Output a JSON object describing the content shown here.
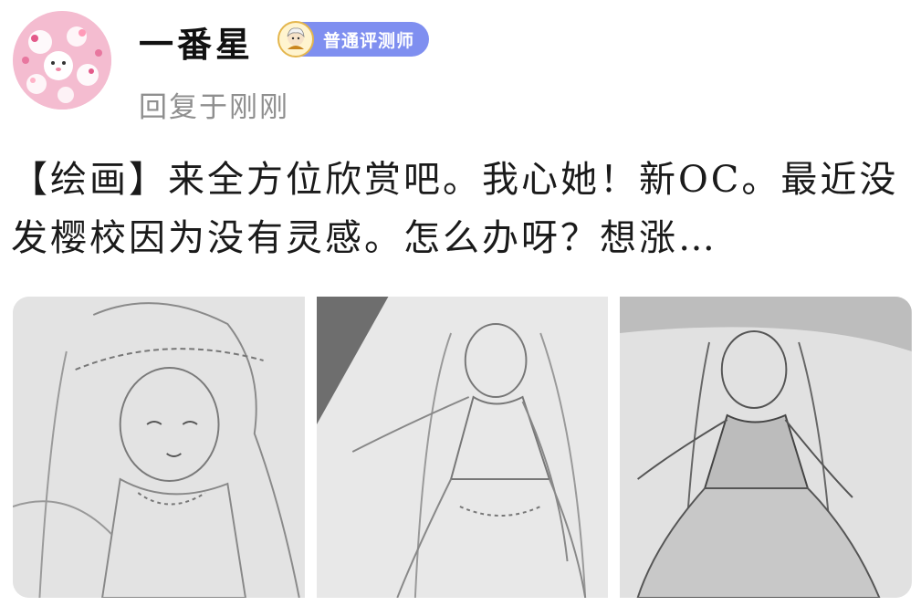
{
  "post": {
    "username": "一番星",
    "badge_label": "普通评测师",
    "reply_time": "回复于刚刚",
    "content": "【绘画】来全方位欣赏吧。我心她！新OC。最近没发樱校因为没有灵感。怎么办呀？想涨…"
  },
  "icons": {
    "avatar": "avatar-pink-cartoon",
    "badge": "reviewer-badge-icon"
  },
  "colors": {
    "badge_bg": "#7f8ff0",
    "reply_time": "#8f8f8f",
    "text": "#1a1a1a"
  },
  "images": [
    {
      "name": "pencil-sketch-closeup"
    },
    {
      "name": "pencil-sketch-full-body-left"
    },
    {
      "name": "pencil-sketch-full-body-right"
    }
  ]
}
